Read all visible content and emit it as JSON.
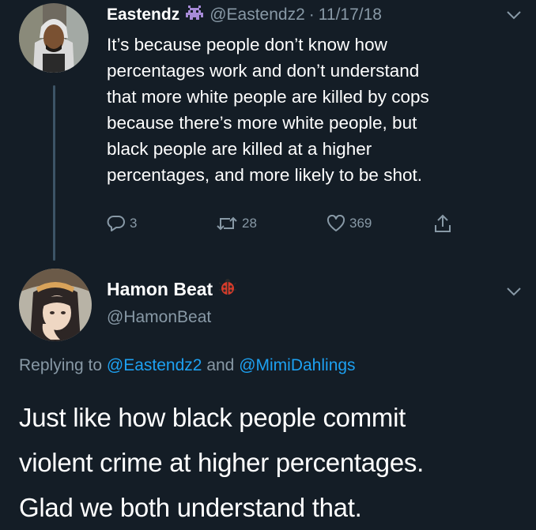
{
  "tweet1": {
    "name": "Eastendz",
    "name_emoji": "👾",
    "handle": "@Eastendz2",
    "separator": "·",
    "date": "11/17/18",
    "lines": [
      "It’s because people don’t know how",
      "percentages work and don’t understand",
      "that more white people are killed by cops",
      "because there’s more white people, but",
      "black people are killed at a higher",
      "percentages, and more likely to be shot."
    ],
    "replies": "3",
    "retweets": "28",
    "likes": "369"
  },
  "tweet2": {
    "name": "Hamon Beat",
    "name_emoji": "🐞",
    "handle": "@HamonBeat",
    "replying_prefix": "Replying to",
    "mention1": "@Eastendz2",
    "conjunction": "and",
    "mention2": "@MimiDahlings",
    "lines": [
      "Just like how black people commit",
      "violent crime at higher percentages.",
      "Glad we both understand that."
    ]
  },
  "colors": {
    "background": "#141d26",
    "text": "#ffffff",
    "secondary": "#8899a6",
    "link": "#1da1f2",
    "thread_line": "#3d5466"
  },
  "icons": [
    "reply-icon",
    "retweet-icon",
    "like-icon",
    "share-icon",
    "chevron-down-icon"
  ]
}
